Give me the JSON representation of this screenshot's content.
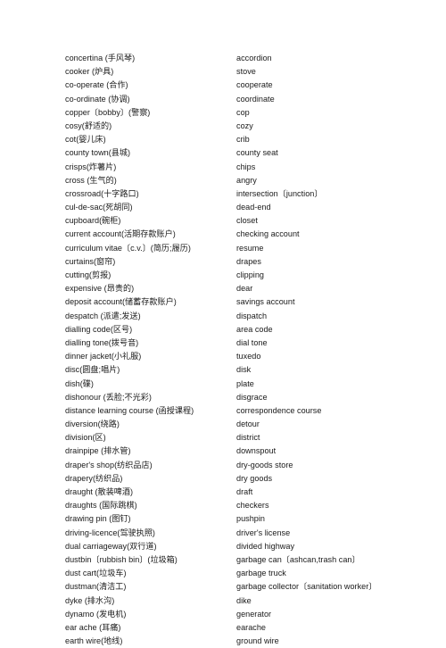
{
  "document": {
    "type": "bilingual-vocabulary-list",
    "columns": {
      "left_label": "",
      "right_label": ""
    },
    "entries": [
      {
        "british": "concertina (手风琴)",
        "american": "accordion"
      },
      {
        "british": "cooker (炉具)",
        "american": "stove"
      },
      {
        "british": "co-operate (合作)",
        "american": "cooperate"
      },
      {
        "british": "co-ordinate (协调)",
        "american": "coordinate"
      },
      {
        "british": "copper〔bobby〕(警察)",
        "american": "cop"
      },
      {
        "british": "cosy(舒适的)",
        "american": "cozy"
      },
      {
        "british": "cot(婴儿床)",
        "american": "crib"
      },
      {
        "british": "county town(县城)",
        "american": "county seat"
      },
      {
        "british": "crisps(炸薯片)",
        "american": "chips"
      },
      {
        "british": "cross (生气的)",
        "american": "angry"
      },
      {
        "british": "crossroad(十字路口)",
        "american": "intersection〔junction〕"
      },
      {
        "british": "cul-de-sac(死胡同)",
        "american": "dead-end"
      },
      {
        "british": "cupboard(碗柜)",
        "american": "closet"
      },
      {
        "british": "current account(活期存款账户)",
        "american": "checking account"
      },
      {
        "british": "curriculum vitae〔c.v.〕(简历;履历)",
        "american": "resume"
      },
      {
        "british": "curtains(窗帘)",
        "american": "drapes"
      },
      {
        "british": "cutting(剪报)",
        "american": "clipping"
      },
      {
        "british": "expensive (昂贵的)",
        "american": "dear"
      },
      {
        "british": "deposit account(储蓄存款账户)",
        "american": "savings account"
      },
      {
        "british": "despatch (派遣;发送)",
        "american": "dispatch"
      },
      {
        "british": "dialling code(区号)",
        "american": "area code"
      },
      {
        "british": "dialling tone(拨号音)",
        "american": "dial tone"
      },
      {
        "british": "dinner jacket(小礼服)",
        "american": "tuxedo"
      },
      {
        "british": "disc(圆盘;唱片)",
        "american": "disk"
      },
      {
        "british": "dish(碟)",
        "american": "plate"
      },
      {
        "british": "dishonour (丢脸;不光彩)",
        "american": "disgrace"
      },
      {
        "british": "distance learning course (函授课程)",
        "american": "correspondence course"
      },
      {
        "british": "diversion(绕路)",
        "american": "detour"
      },
      {
        "british": "division(区)",
        "american": "district"
      },
      {
        "british": "drainpipe (排水管)",
        "american": "downspout"
      },
      {
        "british": "draper's shop(纺织品店)",
        "american": "dry-goods store"
      },
      {
        "british": "drapery(纺织品)",
        "american": "dry goods"
      },
      {
        "british": "draught (散装啤酒)",
        "american": "draft"
      },
      {
        "british": "draughts (国际跳棋)",
        "american": "checkers"
      },
      {
        "british": "drawing pin (图钉)",
        "american": "pushpin"
      },
      {
        "british": "driving-licence(驾驶执照)",
        "american": "driver's license"
      },
      {
        "british": "dual carriageway(双行道)",
        "american": "divided highway"
      },
      {
        "british": "dustbin〔rubbish bin〕(垃圾箱)",
        "american": "garbage can〔ashcan,trash can〕"
      },
      {
        "british": "dust cart(垃圾车)",
        "american": "garbage truck"
      },
      {
        "british": "dustman(清洁工)",
        "american": "garbage collector〔sanitation worker〕"
      },
      {
        "british": "dyke (排水沟)",
        "american": "dike"
      },
      {
        "british": "dynamo (发电机)",
        "american": "generator"
      },
      {
        "british": "ear ache (耳痛)",
        "american": "earache"
      },
      {
        "british": "earth wire(地线)",
        "american": "ground wire"
      }
    ]
  },
  "colors": {
    "page_background": "#ffffff",
    "text": "#1a1a1a"
  }
}
